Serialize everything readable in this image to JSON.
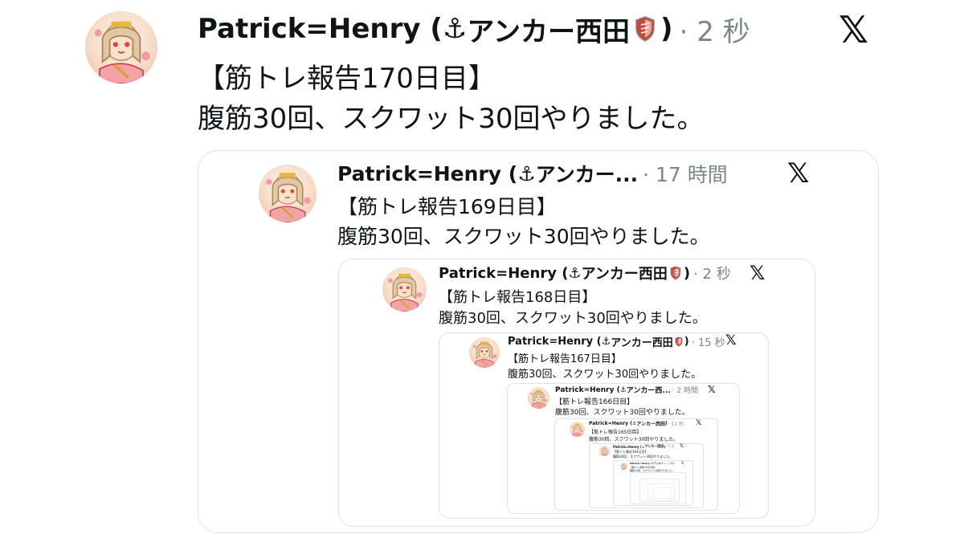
{
  "posts": [
    {
      "name": "Patrick=Henry (",
      "anchor": "⚓",
      "suffix": "アンカー西田",
      "close": ")",
      "time": "· 2 秒",
      "logo": "𝕏",
      "title": "【筋トレ報告170日目】",
      "body": "腹筋30回、スクワット30回やりました。"
    },
    {
      "name": "Patrick=Henry (",
      "anchor": "⚓",
      "suffix": "アンカー...",
      "close": "",
      "time": "· 17 時間",
      "logo": "𝕏",
      "title": "【筋トレ報告169日目】",
      "body": "腹筋30回、スクワット30回やりました。"
    },
    {
      "name": "Patrick=Henry (",
      "anchor": "⚓",
      "suffix": "アンカー西田",
      "close": ")",
      "time": "· 2 秒",
      "logo": "𝕏",
      "title": "【筋トレ報告168日目】",
      "body": "腹筋30回、スクワット30回やりました。"
    },
    {
      "name": "Patrick=Henry (",
      "anchor": "⚓",
      "suffix": "アンカー西田",
      "close": ")",
      "time": "· 15 秒",
      "logo": "𝕏",
      "title": "【筋トレ報告167日目】",
      "body": "腹筋30回、スクワット30回やりました。"
    },
    {
      "name": "Patrick=Henry (",
      "anchor": "⚓",
      "suffix": "アンカー西...",
      "close": "",
      "time": "· 2 時間",
      "logo": "𝕏",
      "title": "【筋トレ報告166日目】",
      "body": "腹筋30回、スクワット30回やりました。"
    },
    {
      "name": "Patrick=Henry (",
      "anchor": "⚓",
      "suffix": "アンカー西田",
      "close": ")",
      "time": "· 11 秒",
      "logo": "𝕏",
      "title": "【筋トレ報告165日目】",
      "body": "腹筋30回、スクワット30回やりました。"
    },
    {
      "name": "Patrick=Henry (",
      "anchor": "⚓",
      "suffix": "アンカー西田",
      "close": ")",
      "time": "· 1 分",
      "logo": "𝕏",
      "title": "【筋トレ報告164日目】",
      "body": "腹筋30回、スクワット30回やりました。"
    },
    {
      "name": "Patrick=Henry (",
      "anchor": "⚓",
      "suffix": "アンカー...",
      "close": "",
      "time": "· 1 時間",
      "logo": "𝕏",
      "title": "【筋トレ報告163日目】",
      "body": "腹筋30回、スクワット30回やりました。"
    }
  ],
  "colors": {
    "shield": "#c8463a",
    "shield_light": "#e8a8a0",
    "meta": "#7a8690",
    "card_border": "#dfe3e7"
  },
  "icons": {
    "logo": "x-logo-icon",
    "anchor": "anchor-icon",
    "shield": "shield-icon",
    "avatar": "avatar-illustration"
  }
}
